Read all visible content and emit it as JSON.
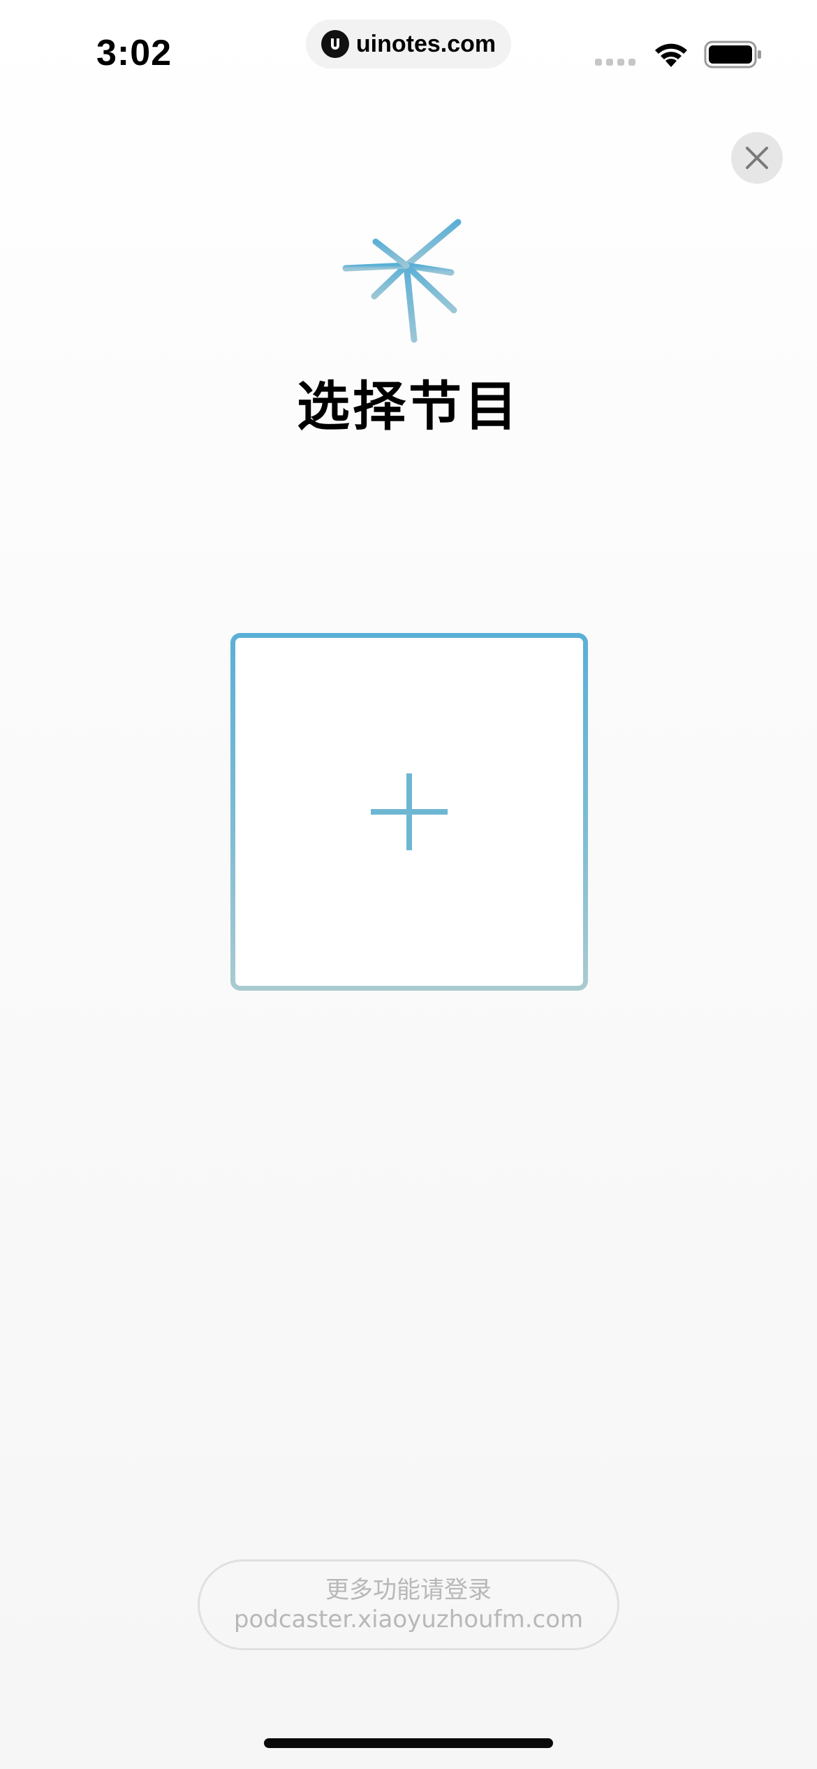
{
  "status_bar": {
    "time": "3:02",
    "watermark": "uinotes.com",
    "icons": [
      "signal-icon",
      "wifi-icon",
      "battery-icon"
    ]
  },
  "header": {
    "close_icon": "close-icon"
  },
  "main": {
    "logo_icon": "asterisk-star-icon",
    "title": "选择节目",
    "add_card_icon": "plus-icon"
  },
  "footer": {
    "login_line1": "更多功能请登录",
    "login_line2": "podcaster.xiaoyuzhoufm.com"
  },
  "colors": {
    "accent_blue": "#5aafd6",
    "accent_teal": "#a9cbd0",
    "muted_text": "#b8b8b8",
    "close_bg": "#e6e6e6"
  }
}
